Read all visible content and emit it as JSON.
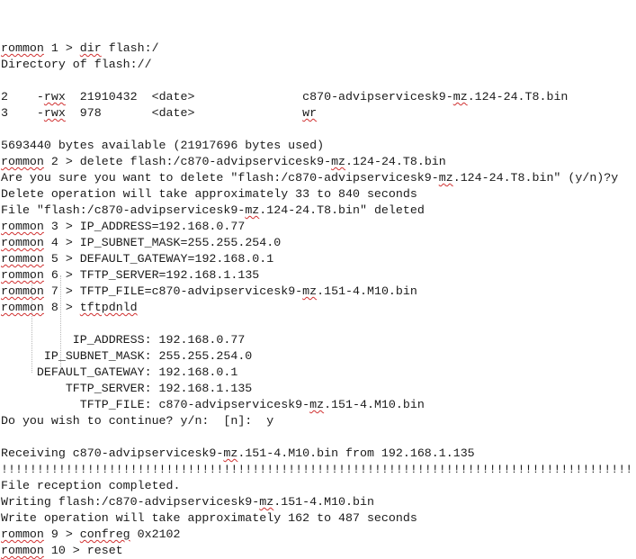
{
  "document": {
    "lines": [
      {
        "segments": [
          {
            "t": "rommon",
            "s": true
          },
          {
            "t": " 1 > "
          },
          {
            "t": "dir",
            "s": true
          },
          {
            "t": " flash:/"
          }
        ]
      },
      {
        "segments": [
          {
            "t": "Directory of flash://"
          }
        ]
      },
      {
        "segments": [
          {
            "t": ""
          }
        ]
      },
      {
        "segments": [
          {
            "t": "2    -"
          },
          {
            "t": "rwx",
            "s": true
          },
          {
            "t": "  21910432  <date>               c870-advipservicesk9-"
          },
          {
            "t": "mz",
            "s": true
          },
          {
            "t": ".124-24.T8.bin"
          }
        ]
      },
      {
        "segments": [
          {
            "t": "3    -"
          },
          {
            "t": "rwx",
            "s": true
          },
          {
            "t": "  978       <date>               "
          },
          {
            "t": "wr",
            "s": true
          }
        ]
      },
      {
        "segments": [
          {
            "t": ""
          }
        ]
      },
      {
        "segments": [
          {
            "t": "5693440 bytes available (21917696 bytes used)"
          }
        ]
      },
      {
        "segments": [
          {
            "t": "rommon",
            "s": true
          },
          {
            "t": " 2 > delete flash:/c870-advipservicesk9-"
          },
          {
            "t": "mz",
            "s": true
          },
          {
            "t": ".124-24.T8.bin"
          }
        ]
      },
      {
        "segments": [
          {
            "t": "Are you sure you want to delete \"flash:/c870-advipservicesk9-"
          },
          {
            "t": "mz",
            "s": true
          },
          {
            "t": ".124-24.T8.bin\" (y/n)?y"
          }
        ]
      },
      {
        "segments": [
          {
            "t": "Delete operation will take approximately 33 to 840 seconds"
          }
        ]
      },
      {
        "segments": [
          {
            "t": "File \"flash:/c870-advipservicesk9-"
          },
          {
            "t": "mz",
            "s": true
          },
          {
            "t": ".124-24.T8.bin\" deleted"
          }
        ]
      },
      {
        "segments": [
          {
            "t": "rommon",
            "s": true
          },
          {
            "t": " 3 > IP_ADDRESS=192.168.0.77"
          }
        ]
      },
      {
        "segments": [
          {
            "t": "rommon",
            "s": true
          },
          {
            "t": " 4 > IP_SUBNET_MASK=255.255.254.0"
          }
        ]
      },
      {
        "segments": [
          {
            "t": "rommon",
            "s": true
          },
          {
            "t": " 5 > DEFAULT_GATEWAY=192.168.0.1"
          }
        ]
      },
      {
        "segments": [
          {
            "t": "rommon",
            "s": true
          },
          {
            "t": " 6 > TFTP_SERVER=192.168.1.135"
          }
        ]
      },
      {
        "segments": [
          {
            "t": "rommon",
            "s": true
          },
          {
            "t": " 7 > TFTP_FILE=c870-advipservicesk9-"
          },
          {
            "t": "mz",
            "s": true
          },
          {
            "t": ".151-4.M10.bin"
          }
        ]
      },
      {
        "segments": [
          {
            "t": "rommon",
            "s": true
          },
          {
            "t": " 8 > "
          },
          {
            "t": "tftpdnld",
            "s": true
          }
        ]
      },
      {
        "segments": [
          {
            "t": ""
          }
        ]
      },
      {
        "segments": [
          {
            "t": "          IP_ADDRESS: 192.168.0.77"
          }
        ]
      },
      {
        "segments": [
          {
            "t": "      IP_SUBNET_MASK: 255.255.254.0"
          }
        ]
      },
      {
        "segments": [
          {
            "t": "     DEFAULT_GATEWAY: 192.168.0.1"
          }
        ]
      },
      {
        "segments": [
          {
            "t": "         TFTP_SERVER: 192.168.1.135"
          }
        ]
      },
      {
        "segments": [
          {
            "t": "           TFTP_FILE: c870-advipservicesk9-"
          },
          {
            "t": "mz",
            "s": true
          },
          {
            "t": ".151-4.M10.bin"
          }
        ]
      },
      {
        "segments": [
          {
            "t": "Do you wish to continue? y/n:  [n]:  y"
          }
        ]
      },
      {
        "segments": [
          {
            "t": ""
          }
        ]
      },
      {
        "segments": [
          {
            "t": "Receiving c870-advipservicesk9-"
          },
          {
            "t": "mz",
            "s": true
          },
          {
            "t": ".151-4.M10.bin from 192.168.1.135"
          }
        ]
      },
      {
        "segments": [
          {
            "t": "!!!!!!!!!!!!!!!!!!!!!!!!!!!!!!!!!!!!!!!!!!!!!!!!!!!!!!!!!!!!!!!!!!!!!!!!!!!!!!!!!!!!!!!!"
          }
        ]
      },
      {
        "segments": [
          {
            "t": "File reception completed."
          }
        ]
      },
      {
        "segments": [
          {
            "t": "Writing flash:/c870-advipservicesk9-"
          },
          {
            "t": "mz",
            "s": true
          },
          {
            "t": ".151-4.M10.bin"
          }
        ]
      },
      {
        "segments": [
          {
            "t": "Write operation will take approximately 162 to 487 seconds"
          }
        ]
      },
      {
        "segments": [
          {
            "t": "rommon",
            "s": true
          },
          {
            "t": " 9 > "
          },
          {
            "t": "confreg",
            "s": true
          },
          {
            "t": " 0x2102"
          }
        ]
      },
      {
        "segments": [
          {
            "t": "rommon",
            "s": true
          },
          {
            "t": " 10 > reset"
          }
        ]
      }
    ]
  }
}
